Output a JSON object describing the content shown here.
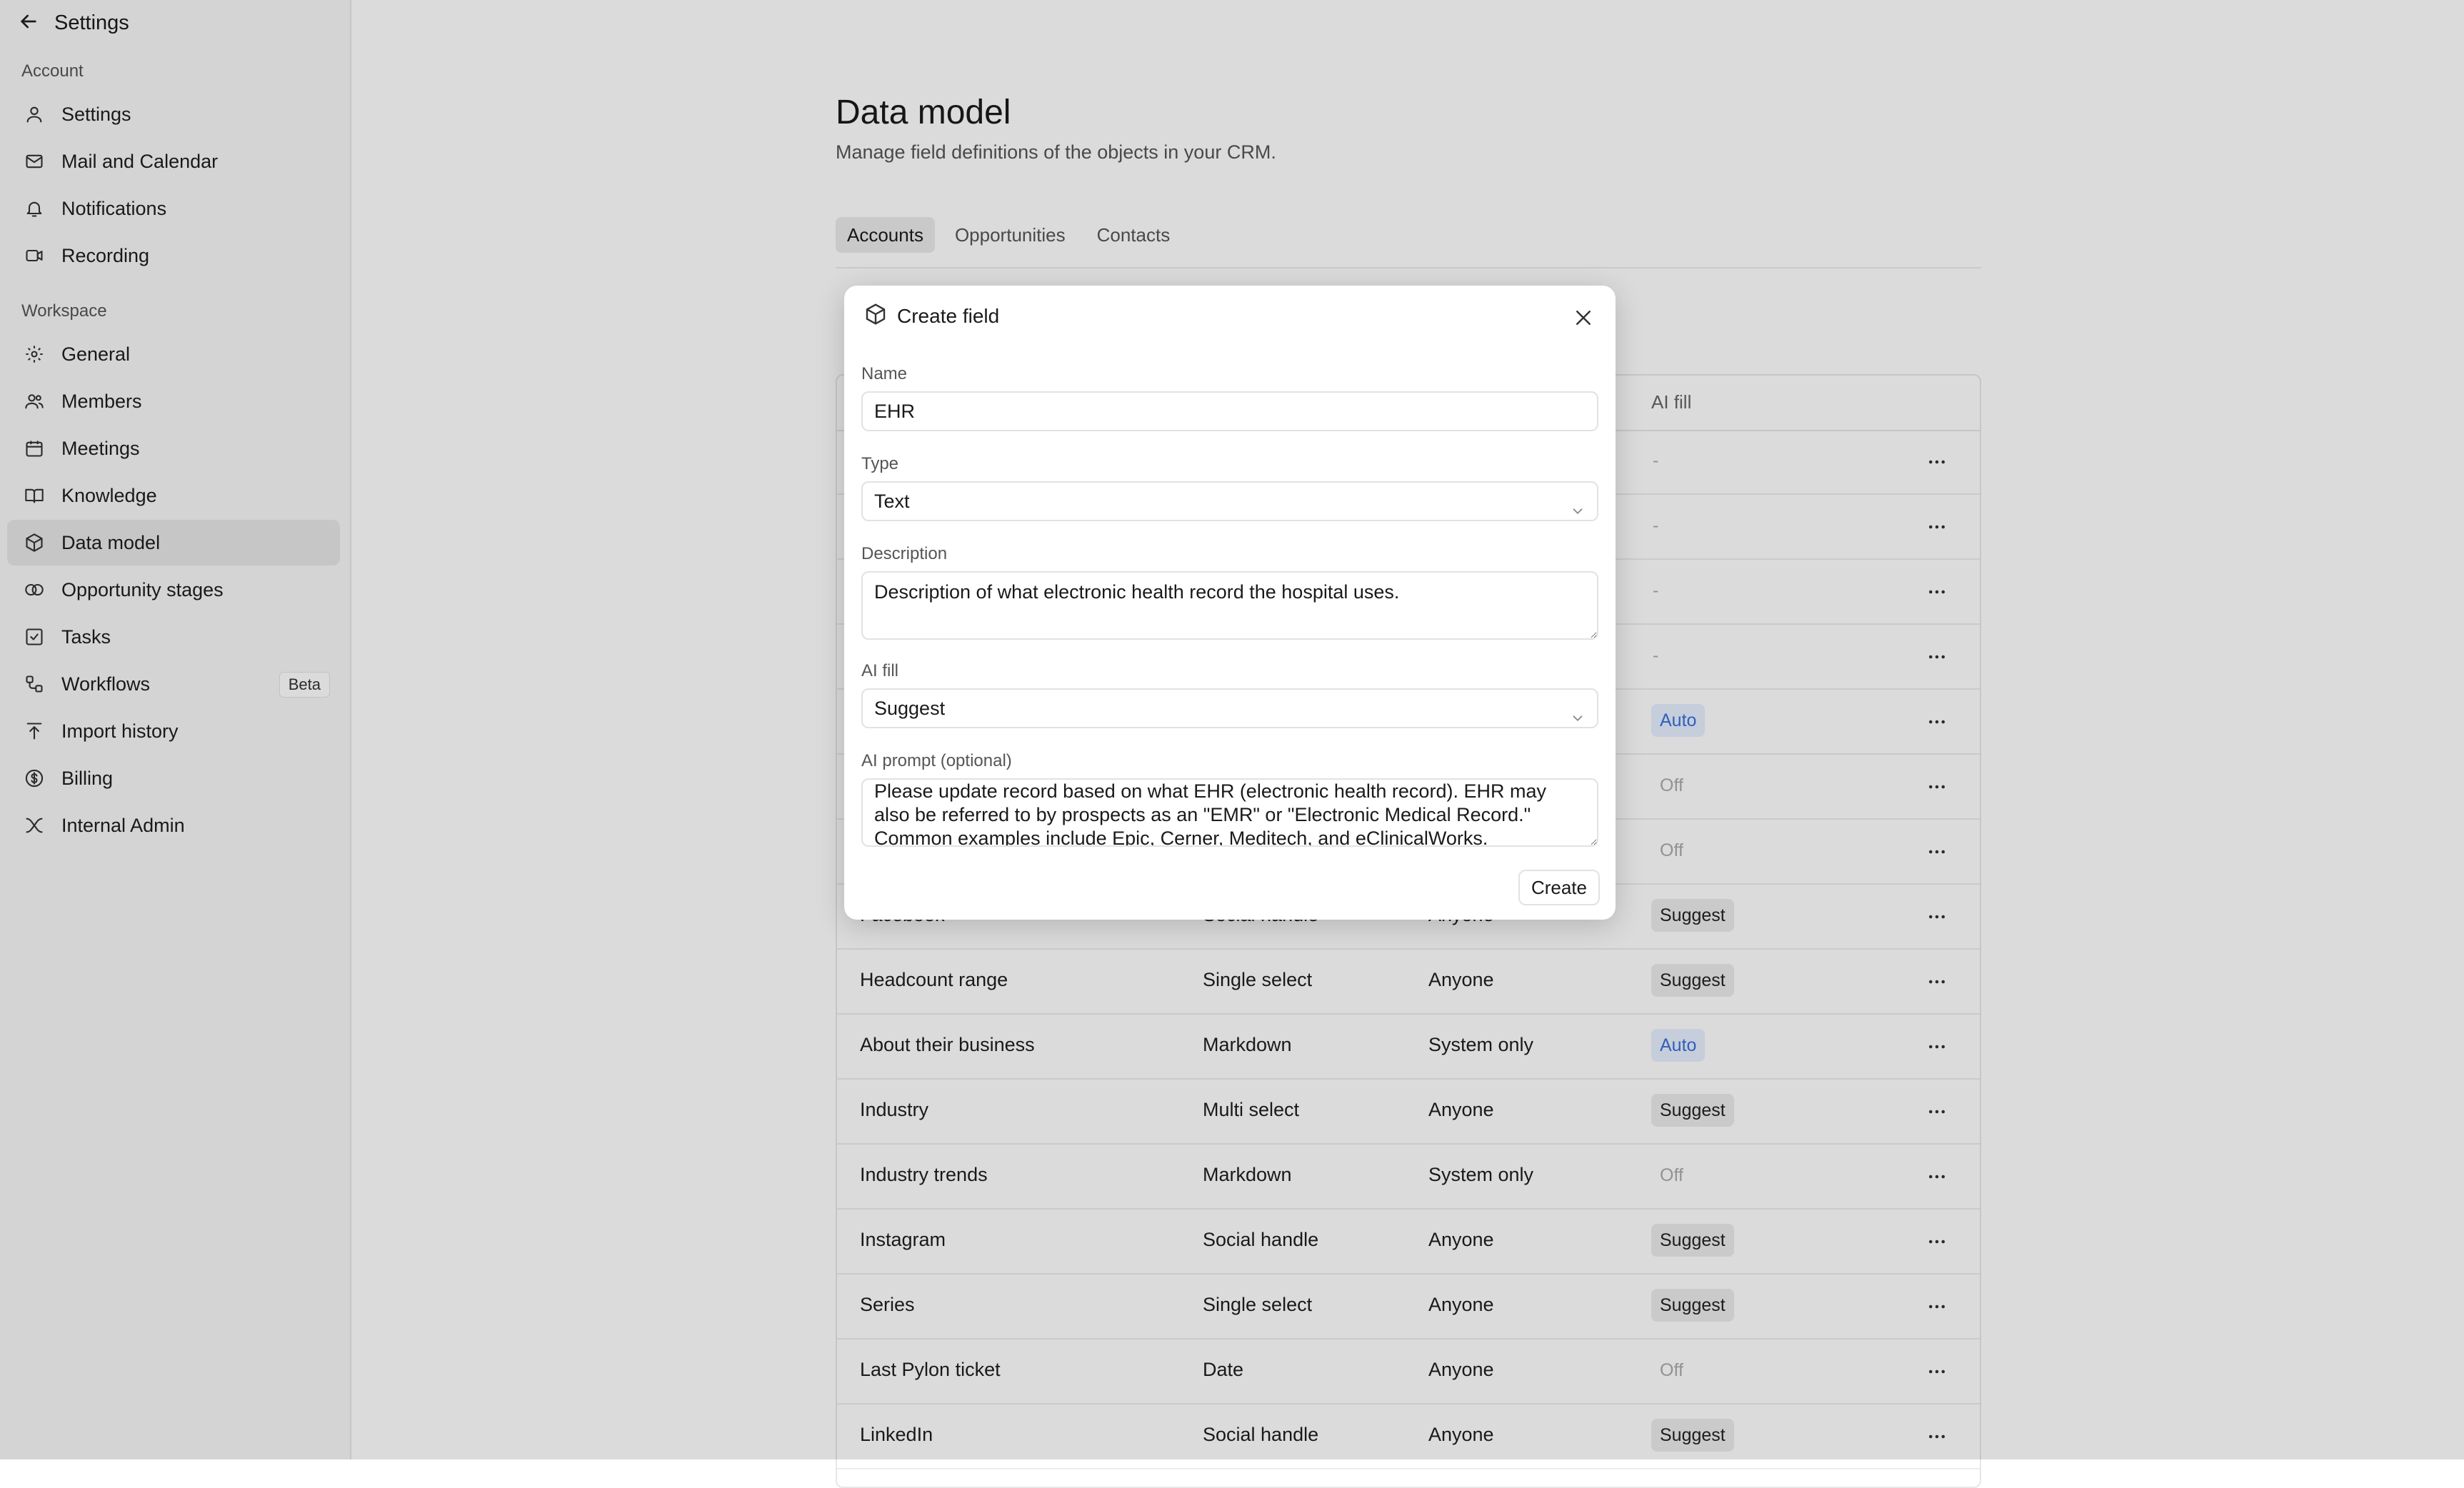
{
  "sidebar": {
    "back_label": "Settings",
    "sections": {
      "account": "Account",
      "workspace": "Workspace"
    },
    "account_items": [
      {
        "label": "Settings",
        "icon": "user-icon"
      },
      {
        "label": "Mail and Calendar",
        "icon": "mail-icon"
      },
      {
        "label": "Notifications",
        "icon": "bell-icon"
      },
      {
        "label": "Recording",
        "icon": "video-icon"
      }
    ],
    "workspace_items": [
      {
        "label": "General",
        "icon": "gear-icon"
      },
      {
        "label": "Members",
        "icon": "users-icon"
      },
      {
        "label": "Meetings",
        "icon": "calendar-icon"
      },
      {
        "label": "Knowledge",
        "icon": "book-icon"
      },
      {
        "label": "Data model",
        "icon": "cube-icon",
        "active": true
      },
      {
        "label": "Opportunity stages",
        "icon": "stages-icon"
      },
      {
        "label": "Tasks",
        "icon": "checkbox-icon"
      },
      {
        "label": "Workflows",
        "icon": "workflow-icon",
        "badge": "Beta"
      },
      {
        "label": "Import history",
        "icon": "upload-icon"
      },
      {
        "label": "Billing",
        "icon": "dollar-icon"
      },
      {
        "label": "Internal Admin",
        "icon": "admin-icon"
      }
    ]
  },
  "main": {
    "title": "Data model",
    "subtitle": "Manage field definitions of the objects in your CRM.",
    "tabs": [
      {
        "label": "Accounts",
        "active": true
      },
      {
        "label": "Opportunities"
      },
      {
        "label": "Contacts"
      }
    ],
    "table": {
      "headers": {
        "ai_fill": "AI fill"
      },
      "rows": [
        {
          "name": "",
          "type": "",
          "access": "",
          "ai": "-"
        },
        {
          "name": "",
          "type": "",
          "access": "",
          "ai": "-"
        },
        {
          "name": "",
          "type": "",
          "access": "",
          "ai": "-"
        },
        {
          "name": "",
          "type": "",
          "access": "",
          "ai": "-"
        },
        {
          "name": "",
          "type": "",
          "access": "",
          "ai": "Auto"
        },
        {
          "name": "",
          "type": "",
          "access": "",
          "ai": "Off"
        },
        {
          "name": "",
          "type": "",
          "access": "",
          "ai": "Off"
        },
        {
          "name": "Facebook",
          "type": "Social handle",
          "access": "Anyone",
          "ai": "Suggest"
        },
        {
          "name": "Headcount range",
          "type": "Single select",
          "access": "Anyone",
          "ai": "Suggest"
        },
        {
          "name": "About their business",
          "type": "Markdown",
          "access": "System only",
          "ai": "Auto"
        },
        {
          "name": "Industry",
          "type": "Multi select",
          "access": "Anyone",
          "ai": "Suggest"
        },
        {
          "name": "Industry trends",
          "type": "Markdown",
          "access": "System only",
          "ai": "Off"
        },
        {
          "name": "Instagram",
          "type": "Social handle",
          "access": "Anyone",
          "ai": "Suggest"
        },
        {
          "name": "Series",
          "type": "Single select",
          "access": "Anyone",
          "ai": "Suggest"
        },
        {
          "name": "Last Pylon ticket",
          "type": "Date",
          "access": "Anyone",
          "ai": "Off"
        },
        {
          "name": "LinkedIn",
          "type": "Social handle",
          "access": "Anyone",
          "ai": "Suggest"
        }
      ]
    }
  },
  "modal": {
    "title": "Create field",
    "name_label": "Name",
    "name_value": "EHR",
    "type_label": "Type",
    "type_value": "Text",
    "description_label": "Description",
    "description_value": "Description of what electronic health record the hospital uses.",
    "ai_fill_label": "AI fill",
    "ai_fill_value": "Suggest",
    "ai_prompt_label": "AI prompt (optional)",
    "ai_prompt_value": "Please update record based on what EHR (electronic health record). EHR may also be referred to by prospects as an \"EMR\" or \"Electronic Medical Record.\" Common examples include Epic, Cerner, Meditech, and eClinicalWorks.",
    "create_label": "Create"
  }
}
